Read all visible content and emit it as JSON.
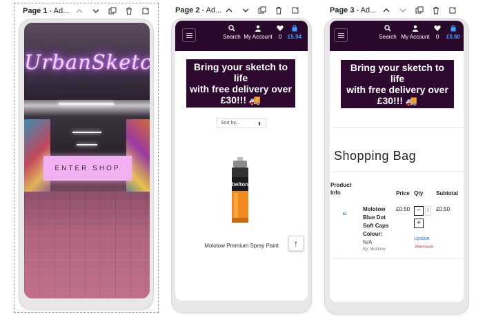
{
  "pages": [
    {
      "label_bold": "Page 1",
      "label_rest": " - Ad..."
    },
    {
      "label_bold": "Page 2",
      "label_rest": " - Ad..."
    },
    {
      "label_bold": "Page 3",
      "label_rest": " - Ad..."
    }
  ],
  "page_controls": [
    "chevron-up-icon",
    "chevron-down-icon",
    "duplicate-icon",
    "trash-icon",
    "add-page-icon"
  ],
  "landing": {
    "logo_text": "UrbanSketch",
    "enter_button": "ENTER SHOP"
  },
  "shop_header": {
    "search_label": "Search",
    "account_label": "My Account",
    "wishlist_count": "0",
    "cart_total_page2": "£5.94",
    "cart_total_page3": "£0.60"
  },
  "banner": {
    "line1": "Bring your sketch to life",
    "line2": "with free delivery over",
    "line3": "£30!!! 🚚"
  },
  "listing": {
    "sort_placeholder": "Sort by...",
    "product_name": "Molotow Premium Spray Paint",
    "can_brand": "belton",
    "back_to_top": "↑"
  },
  "bag": {
    "title": "Shopping Bag",
    "headers": {
      "product_info_1": "Product",
      "product_info_2": "Info",
      "price": "Price",
      "qty": "Qty",
      "subtotal": "Subtotal"
    },
    "item": {
      "name_lines": [
        "Molotow",
        "Blue Dot",
        "Soft Caps"
      ],
      "colour_label": "Colour:",
      "colour_value": "N/A",
      "by": "By: Molotow",
      "price": "£0.50",
      "qty": "1",
      "subtotal": "£0.50",
      "update": "Update",
      "remove": "Remove"
    }
  },
  "colors": {
    "brand_dark": "#2a0a2c",
    "banner_bg": "#2f0a30",
    "cart_blue": "#3aa0ff",
    "button_pink": "#f1b1f0"
  }
}
